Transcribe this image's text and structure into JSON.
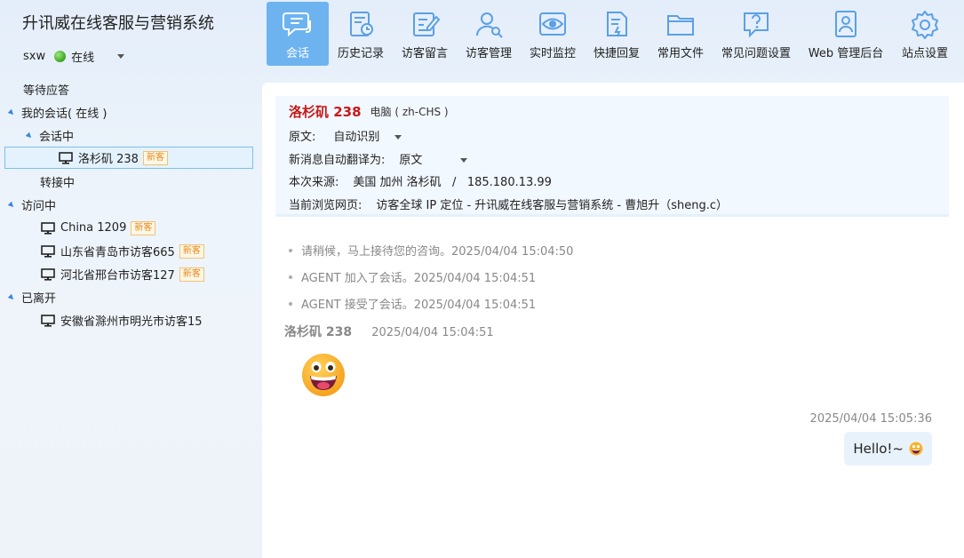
{
  "app": {
    "title": "升讯威在线客服与营销系统"
  },
  "user": {
    "name": "sxw",
    "status": "在线"
  },
  "tree": {
    "waiting": "等待应答",
    "my_sessions": "我的会话( 在线 )",
    "in_session": "会话中",
    "active_visitor": {
      "label": "洛杉矶 238",
      "badge": "新客"
    },
    "transferring": "转接中",
    "visiting": "访问中",
    "visitors": [
      {
        "label": "China 1209",
        "badge": "新客"
      },
      {
        "label": "山东省青岛市访客665",
        "badge": "新客"
      },
      {
        "label": "河北省邢台市访客127",
        "badge": "新客"
      }
    ],
    "left": "已离开",
    "left_visitors": [
      {
        "label": "安徽省滁州市明光市访客15"
      }
    ]
  },
  "toolbar": {
    "items": [
      {
        "label": "会话",
        "icon": "chat-icon",
        "active": true
      },
      {
        "label": "历史记录",
        "icon": "history-icon"
      },
      {
        "label": "访客留言",
        "icon": "message-icon"
      },
      {
        "label": "访客管理",
        "icon": "user-search-icon"
      },
      {
        "label": "实时监控",
        "icon": "eye-icon"
      },
      {
        "label": "快捷回复",
        "icon": "quick-reply-icon"
      },
      {
        "label": "常用文件",
        "icon": "folder-icon"
      },
      {
        "label": "常见问题设置",
        "icon": "faq-icon"
      },
      {
        "label": "Web 管理后台",
        "icon": "admin-icon"
      },
      {
        "label": "站点设置",
        "icon": "settings-icon"
      }
    ]
  },
  "info": {
    "visitor_name": "洛杉矶 238",
    "device": "电脑 ( zh-CHS )",
    "original_label": "原文:",
    "original_value": "自动识别",
    "translate_label": "新消息自动翻译为:",
    "translate_value": "原文",
    "source_label": "本次来源:",
    "source_value": "美国 加州 洛杉矶   /   185.180.13.99",
    "page_label": "当前浏览网页:",
    "page_value": "访客全球 IP 定位 - 升讯威在线客服与营销系统 - 曹旭升（sheng.c）"
  },
  "messages": {
    "system": [
      "请稍候，马上接待您的咨询。2025/04/04 15:04:50",
      "AGENT 加入了会话。2025/04/04 15:04:51",
      "AGENT 接受了会话。2025/04/04 15:04:51"
    ],
    "visitor": {
      "sender": "洛杉矶 238",
      "time": "2025/04/04 15:04:51",
      "emoji": "grinning-face-emoji"
    },
    "agent": {
      "time": "2025/04/04 15:05:36",
      "text": "Hello!~",
      "emoji": "grinning-face-emoji"
    }
  },
  "colors": {
    "accent": "#6db3f0",
    "icon": "#5aa0e6",
    "visitor_name": "#c81818",
    "badge": "#e58a1b",
    "online": "#3aa520"
  }
}
